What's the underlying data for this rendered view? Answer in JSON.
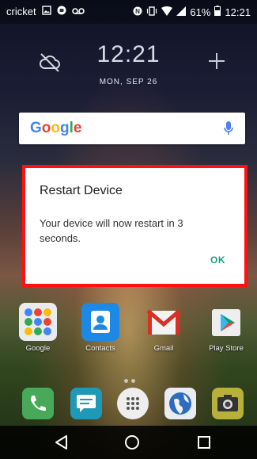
{
  "status_bar": {
    "carrier": "cricket",
    "battery_percent": "61%",
    "time": "12:21"
  },
  "home": {
    "clock_time": "12:21",
    "clock_date": "MON, SEP 26",
    "weather_icon": "cloud-off-icon",
    "search_logo": "Google"
  },
  "dialog": {
    "title": "Restart Device",
    "message": "Your device will now restart in 3 seconds.",
    "ok_label": "OK",
    "highlight_color": "#ff1111",
    "accent_color": "#1a9e86"
  },
  "apps": [
    {
      "label": "Google",
      "icon": "google-folder-icon"
    },
    {
      "label": "Contacts",
      "icon": "contacts-icon"
    },
    {
      "label": "Gmail",
      "icon": "gmail-icon"
    },
    {
      "label": "Play Store",
      "icon": "play-store-icon"
    }
  ],
  "dock": [
    {
      "icon": "phone-icon"
    },
    {
      "icon": "messages-icon"
    },
    {
      "icon": "app-drawer-icon"
    },
    {
      "icon": "browser-icon"
    },
    {
      "icon": "camera-icon"
    }
  ],
  "nav": {
    "back_icon": "back-icon",
    "home_icon": "home-icon",
    "recents_icon": "recents-icon"
  }
}
